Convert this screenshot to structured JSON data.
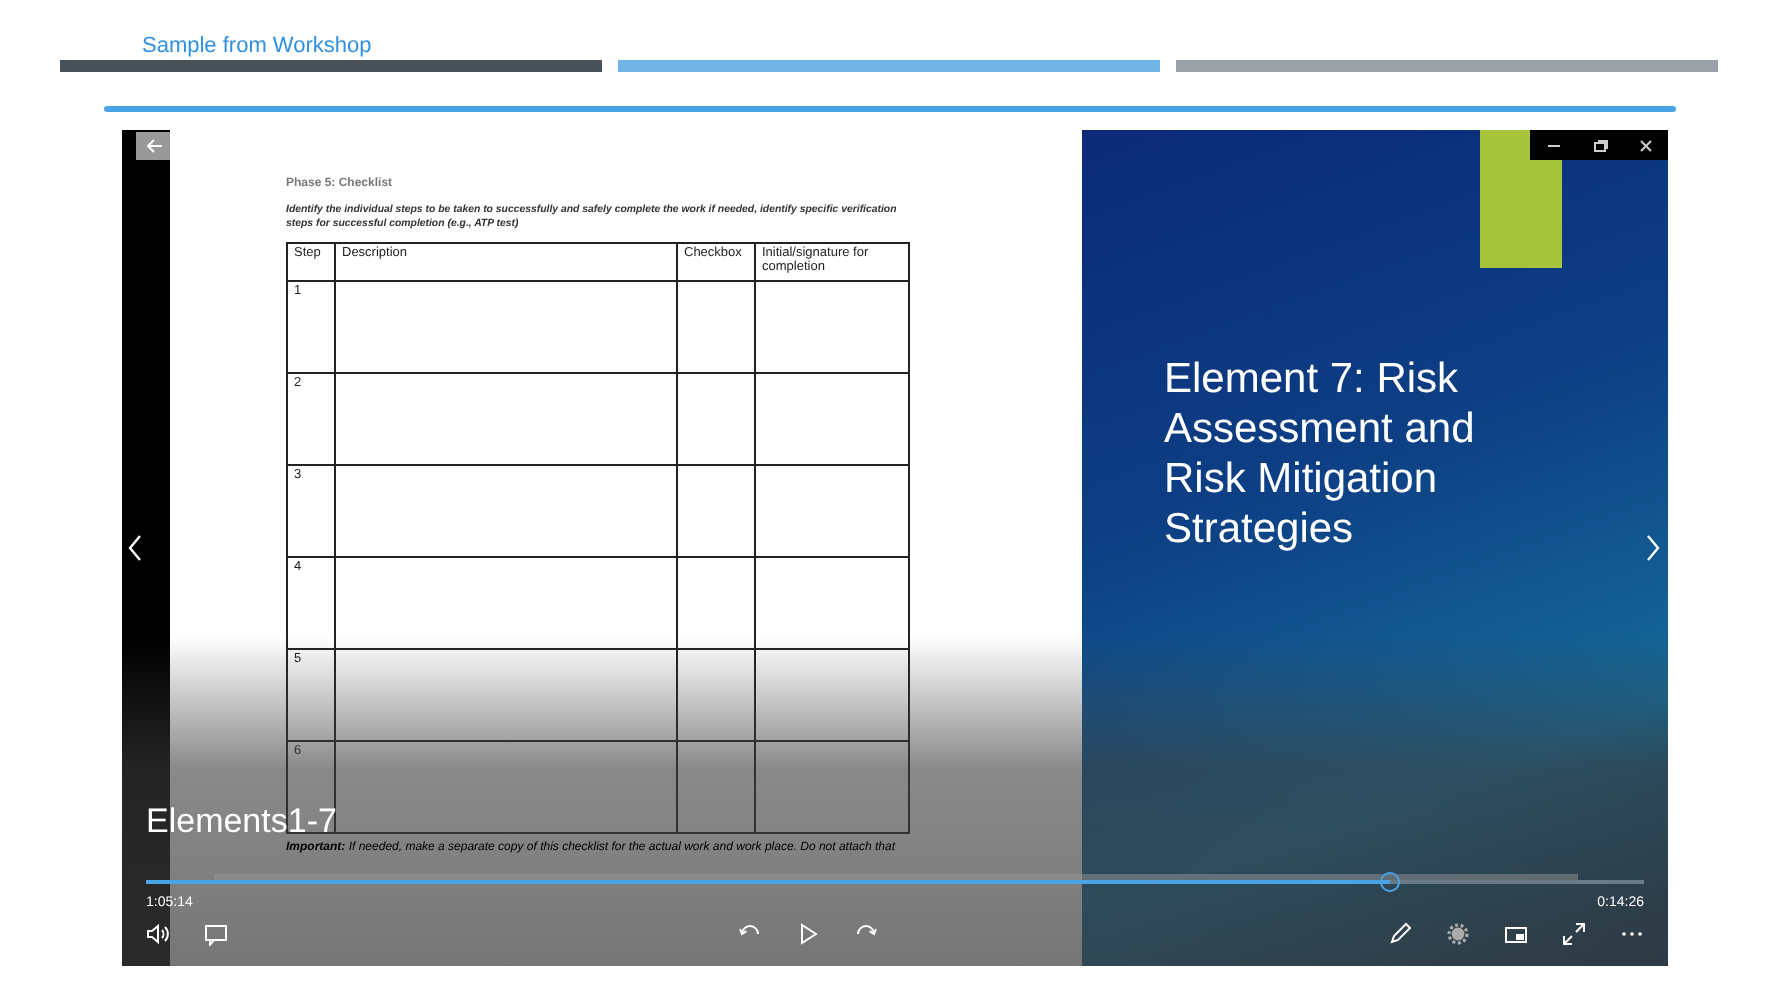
{
  "header": {
    "title": "Sample from Workshop"
  },
  "player": {
    "document": {
      "heading": "Phase 5: Checklist",
      "instructions": "Identify the individual steps to be taken to successfully and safely complete the work if needed, identify specific verification steps for successful completion (e.g., ATP test)",
      "table": {
        "columns": [
          "Step",
          "Description",
          "Checkbox",
          "Initial/signature for completion"
        ],
        "rows": [
          [
            "1"
          ],
          [
            "2"
          ],
          [
            "3"
          ],
          [
            "4"
          ],
          [
            "5"
          ],
          [
            "6"
          ]
        ]
      },
      "note": "**Important:** If needed, make a separate copy of this checklist for the actual work and work place. Do not attach that"
    },
    "slide": {
      "title": "Element 7: Risk Assessment and Risk Mitigation Strategies"
    },
    "video_title": "Elements1-7",
    "progress": {
      "level": 0.83
    },
    "elapsed": "1:05:14",
    "remaining": "0:14:26"
  }
}
